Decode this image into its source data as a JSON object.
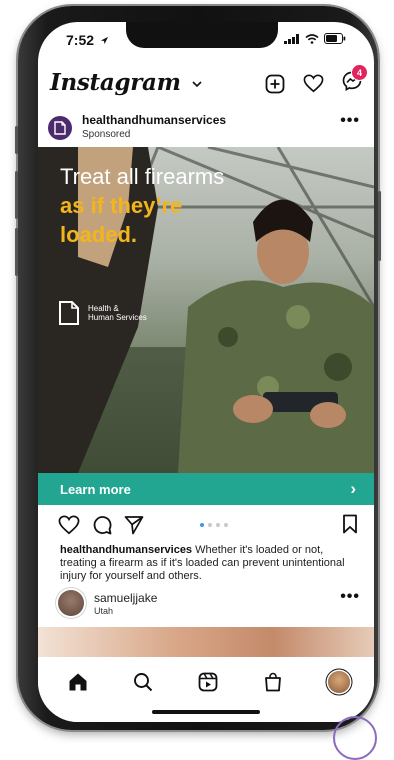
{
  "status_bar": {
    "time": "7:52"
  },
  "app": {
    "name": "Instagram",
    "notification_count": "4"
  },
  "post": {
    "username": "healthandhumanservices",
    "label": "Sponsored",
    "headline_line1": "Treat all firearms",
    "headline_line2": "as if they’re",
    "headline_line3": "loaded.",
    "sponsor_logo_line1": "Health &",
    "sponsor_logo_line2": "Human Services",
    "cta_label": "Learn more",
    "cta_chevron": "›",
    "caption_user": "healthandhumanservices",
    "caption_text": " Whether it's loaded or not, treating a firearm as if it's loaded can prevent unintentional injury for yourself and others."
  },
  "next_post": {
    "username": "samueljjake",
    "location": "Utah"
  },
  "icons": [
    "location-arrow-icon",
    "signal-icon",
    "wifi-icon",
    "battery-icon",
    "chevron-down-icon",
    "new-post-icon",
    "heart-icon",
    "messenger-icon",
    "more-icon",
    "like-icon",
    "comment-icon",
    "share-icon",
    "save-icon",
    "home-icon",
    "search-icon",
    "reels-icon",
    "shop-icon"
  ],
  "colors": {
    "accent_teal": "#22a691",
    "headline_yellow": "#f3b51c",
    "badge_red": "#e0245e",
    "carousel_active": "#3897f0"
  }
}
